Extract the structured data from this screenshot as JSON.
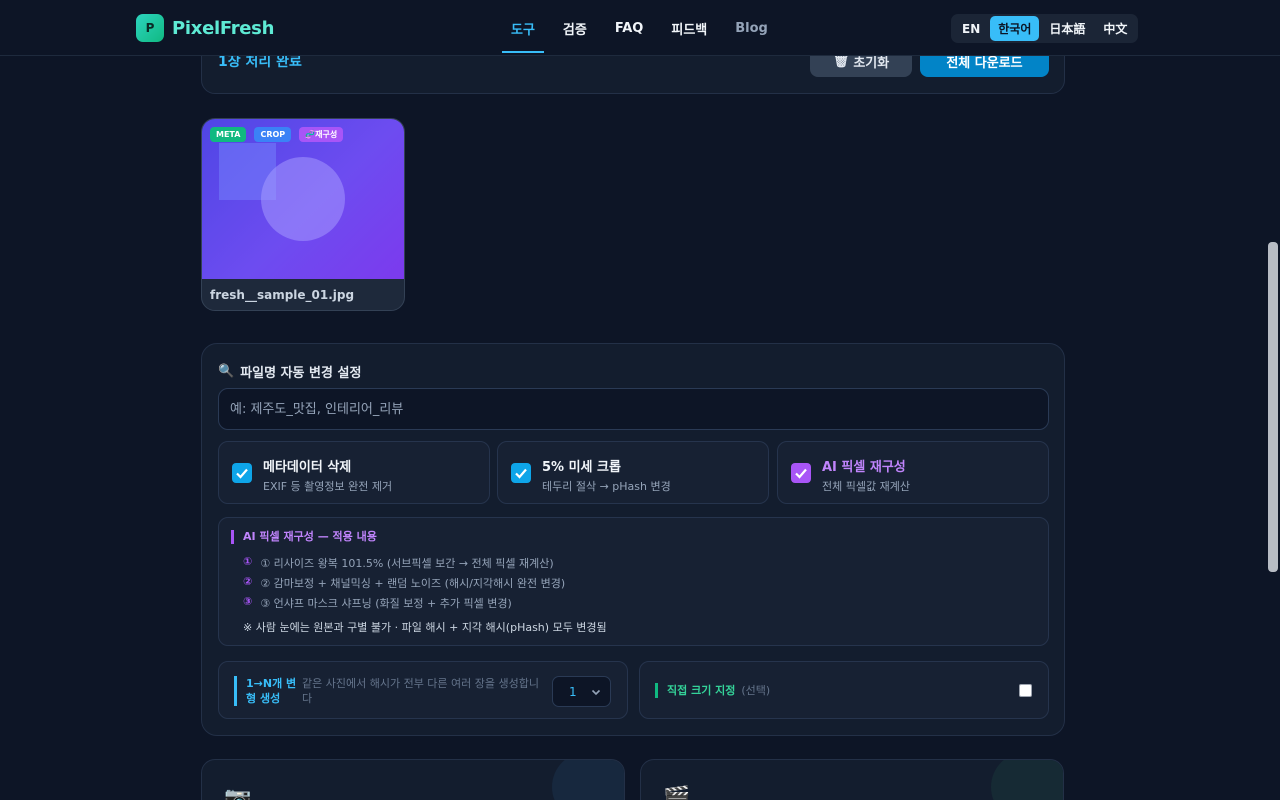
{
  "header": {
    "logo_mark": "P",
    "logo_text": "PixelFresh",
    "nav": [
      "도구",
      "검증",
      "FAQ",
      "피드백",
      "Blog"
    ],
    "languages": [
      "EN",
      "한국어",
      "日本語",
      "中文"
    ]
  },
  "status": {
    "text": "1장 처리 완료",
    "reset_label": "초기화",
    "download_label": "전체 다운로드"
  },
  "thumbnail": {
    "badges": [
      "META",
      "CROP",
      "재구성"
    ],
    "filename": "fresh__sample_01.jpg"
  },
  "settings": {
    "title": "파일명 자동 변경 설정",
    "input_placeholder": "예: 제주도_맛집, 인테리어_리뷰",
    "options": [
      {
        "title": "메타데이터 삭제",
        "sub": "EXIF 등 촬영정보 완전 제거",
        "checked": true,
        "color": "#0ea5e9"
      },
      {
        "title": "5% 미세 크롭",
        "sub": "테두리 절삭 → pHash 변경",
        "checked": true,
        "color": "#0ea5e9"
      },
      {
        "title": "AI 픽셀 재구성",
        "sub": "전체 픽셀값 재계산",
        "checked": true,
        "color": "#a855f7"
      }
    ],
    "info": {
      "title": "AI 픽셀 재구성 — 적용 내용",
      "rows": [
        {
          "num": "①",
          "text": "① 리사이즈 왕복 101.5% (서브픽셀 보간 → 전체 픽셀 재계산)"
        },
        {
          "num": "②",
          "text": "② 감마보정 + 채널믹싱 + 랜덤 노이즈 (해시/지각해시 완전 변경)"
        },
        {
          "num": "③",
          "text": "③ 언샤프 마스크 샤프닝 (화질 보정 + 추가 픽셀 변경)"
        }
      ],
      "note": "※ 사람 눈에는 원본과 구별 불가 · 파일 해시 + 지각 해시(pHash) 모두 변경됨"
    },
    "variants": {
      "label": "1→N개 변형 생성",
      "desc": "같은 사진에서 해시가 전부 다른 여러 장을 생성합니다",
      "value": "1"
    },
    "custom_size": {
      "label": "직접 크기 지정",
      "optional": "(선택)",
      "checked": false
    }
  }
}
